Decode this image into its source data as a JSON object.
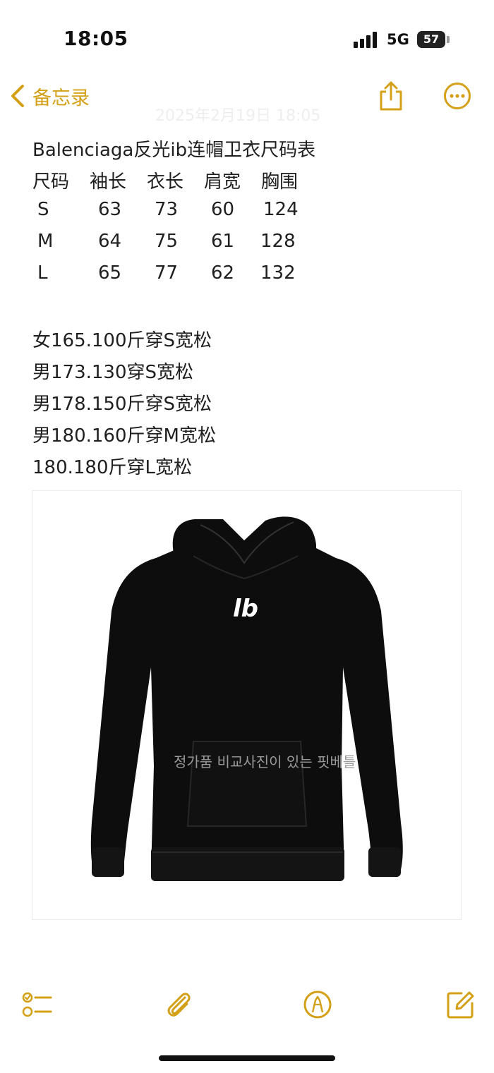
{
  "status_bar": {
    "time": "18:05",
    "network": "5G",
    "battery": "57"
  },
  "nav": {
    "back_label": "备忘录",
    "accent_color": "#d4a017"
  },
  "note": {
    "date_faint": "2025年2月19日 18:05",
    "title": "Balenciaga反光ib连帽卫衣尺码表",
    "table": {
      "headers": [
        "尺码",
        "袖长",
        "衣长",
        "肩宽",
        "胸围"
      ],
      "rows": [
        [
          "S",
          "63",
          "73",
          "60",
          "124"
        ],
        [
          "M",
          "64",
          "75",
          "61",
          "128"
        ],
        [
          "L",
          "65",
          "77",
          "62",
          "132"
        ]
      ]
    },
    "fit_lines": [
      "女165.100斤穿S宽松",
      "男173.130穿S宽松",
      "男178.150斤穿S宽松",
      "男180.160斤穿M宽松",
      "180.180斤穿L宽松"
    ]
  },
  "attachment": {
    "logo_text": "lb",
    "watermark": "정가품 비교사진이 있는 핏베틀"
  },
  "toolbar": {
    "icons": [
      "checklist-icon",
      "paperclip-icon",
      "markup-pen-icon",
      "compose-icon"
    ]
  }
}
